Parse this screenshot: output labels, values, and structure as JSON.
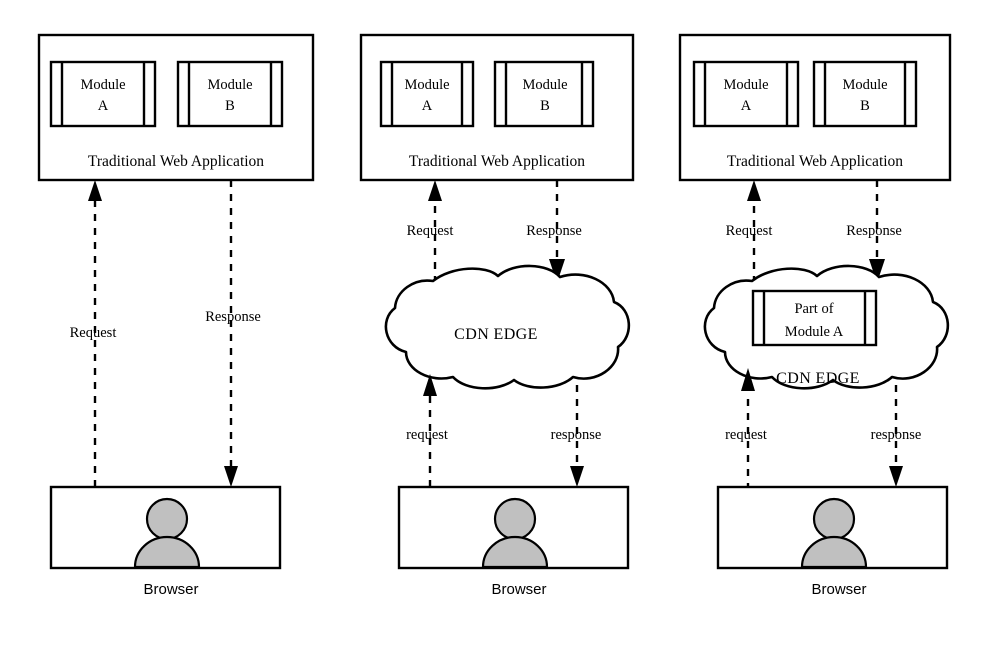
{
  "figure": {
    "title": "CDN Edge Computing Architecture Progression",
    "background_color": "#ffffff",
    "stroke_color": "#000000",
    "person_fill_color": "#c0c0c0"
  },
  "panels": [
    {
      "id": "panel-traditional",
      "app": {
        "label": "Traditional Web Application",
        "modules": [
          {
            "line1": "Module",
            "line2": "A"
          },
          {
            "line1": "Module",
            "line2": "B"
          }
        ]
      },
      "cloud": null,
      "browser": {
        "label": "Browser"
      },
      "flows": [
        {
          "id": "request-up",
          "label": "Request",
          "direction": "up"
        },
        {
          "id": "response-down",
          "label": "Response",
          "direction": "down"
        }
      ]
    },
    {
      "id": "panel-cdn-edge",
      "app": {
        "label": "Traditional Web Application",
        "modules": [
          {
            "line1": "Module",
            "line2": "A"
          },
          {
            "line1": "Module",
            "line2": "B"
          }
        ]
      },
      "cloud": {
        "label": "CDN EDGE",
        "module": null
      },
      "browser": {
        "label": "Browser"
      },
      "flows": [
        {
          "id": "request-up-upper",
          "label": "Request",
          "direction": "up"
        },
        {
          "id": "response-down-upper",
          "label": "Response",
          "direction": "down"
        },
        {
          "id": "request-up-lower",
          "label": "request",
          "direction": "up"
        },
        {
          "id": "response-down-lower",
          "label": "response",
          "direction": "down"
        }
      ]
    },
    {
      "id": "panel-cdn-edge-module",
      "app": {
        "label": "Traditional Web Application",
        "modules": [
          {
            "line1": "Module",
            "line2": "A"
          },
          {
            "line1": "Module",
            "line2": "B"
          }
        ]
      },
      "cloud": {
        "label": "CDN EDGE",
        "module": {
          "line1": "Part of",
          "line2": "Module A"
        }
      },
      "browser": {
        "label": "Browser"
      },
      "flows": [
        {
          "id": "request-up-upper",
          "label": "Request",
          "direction": "up"
        },
        {
          "id": "response-down-upper",
          "label": "Response",
          "direction": "down"
        },
        {
          "id": "request-up-lower",
          "label": "request",
          "direction": "up"
        },
        {
          "id": "response-down-lower",
          "label": "response",
          "direction": "down"
        }
      ]
    }
  ]
}
